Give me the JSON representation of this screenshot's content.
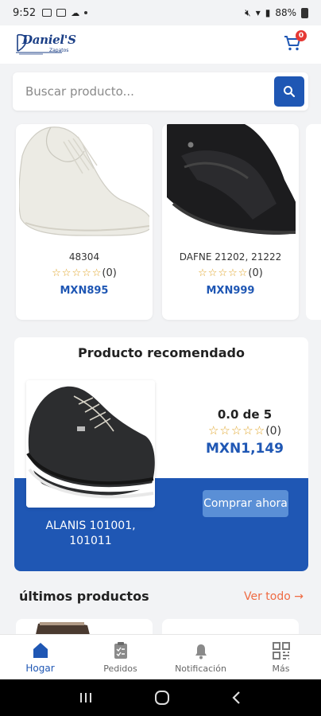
{
  "status_bar": {
    "time": "9:52",
    "battery": "88%"
  },
  "brand": {
    "logo_text": "Daniel'S",
    "logo_sub": "Zapatos"
  },
  "cart": {
    "count": "0"
  },
  "search": {
    "placeholder": "Buscar producto..."
  },
  "products": [
    {
      "name": "48304",
      "rating_count": "(0)",
      "price": "MXN895"
    },
    {
      "name": "DAFNE 21202, 21222",
      "rating_count": "(0)",
      "price": "MXN999"
    }
  ],
  "recommended": {
    "title": "Producto recomendado",
    "product_name": "ALANIS 101001, 101011",
    "score": "0.0 de 5",
    "rating_count": "(0)",
    "price": "MXN1,149",
    "buy_label": "Comprar ahora"
  },
  "latest": {
    "title": "últimos productos",
    "see_all": "Ver todo"
  },
  "nav": [
    {
      "label": "Hogar",
      "icon": "home-icon"
    },
    {
      "label": "Pedidos",
      "icon": "clipboard-icon"
    },
    {
      "label": "Notificación",
      "icon": "bell-icon"
    },
    {
      "label": "Más",
      "icon": "grid-icon"
    }
  ],
  "colors": {
    "primary": "#1f57b4",
    "accent": "#ef6b43",
    "star": "#e0a52a",
    "badge": "#e53935"
  }
}
